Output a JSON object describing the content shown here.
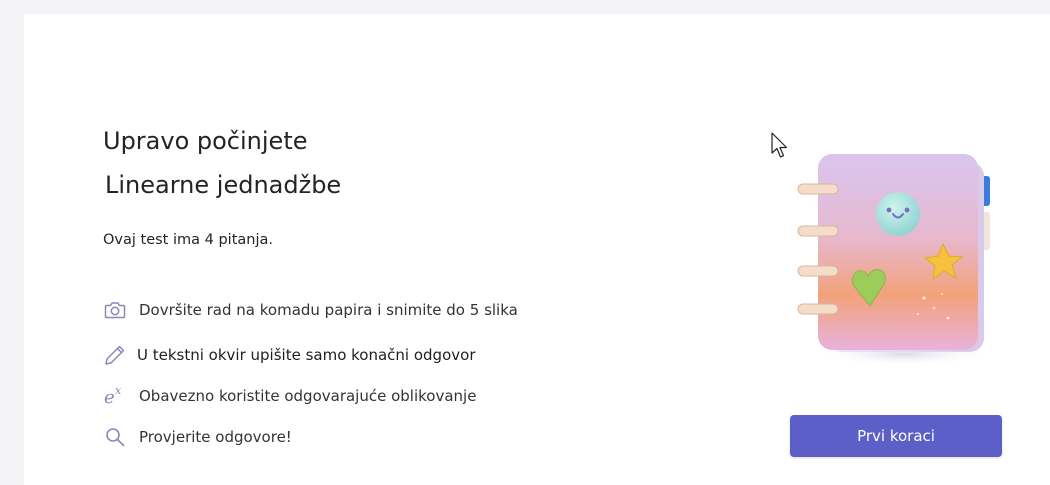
{
  "intro": {
    "line1": "Upravo počinjete",
    "line2": "Linearne jednadžbe"
  },
  "question_count_text": "Ovaj test ima 4 pitanja.",
  "instructions": [
    {
      "icon": "camera-icon",
      "text": "Dovršite rad na komadu papira i snimite do 5 slika"
    },
    {
      "icon": "pencil-icon",
      "text": "U tekstni okvir upišite samo konačni odgovor"
    },
    {
      "icon": "math-format-icon",
      "icon_text": "e",
      "icon_sup": "x",
      "text": "Obavezno koristite odgovarajuće oblikovanje"
    },
    {
      "icon": "search-icon",
      "text": "Provjerite odgovore!"
    }
  ],
  "primary_button": {
    "label": "Prvi koraci"
  },
  "colors": {
    "accent": "#5b5fc7",
    "icon": "#8a88b8",
    "text": "#242424"
  }
}
